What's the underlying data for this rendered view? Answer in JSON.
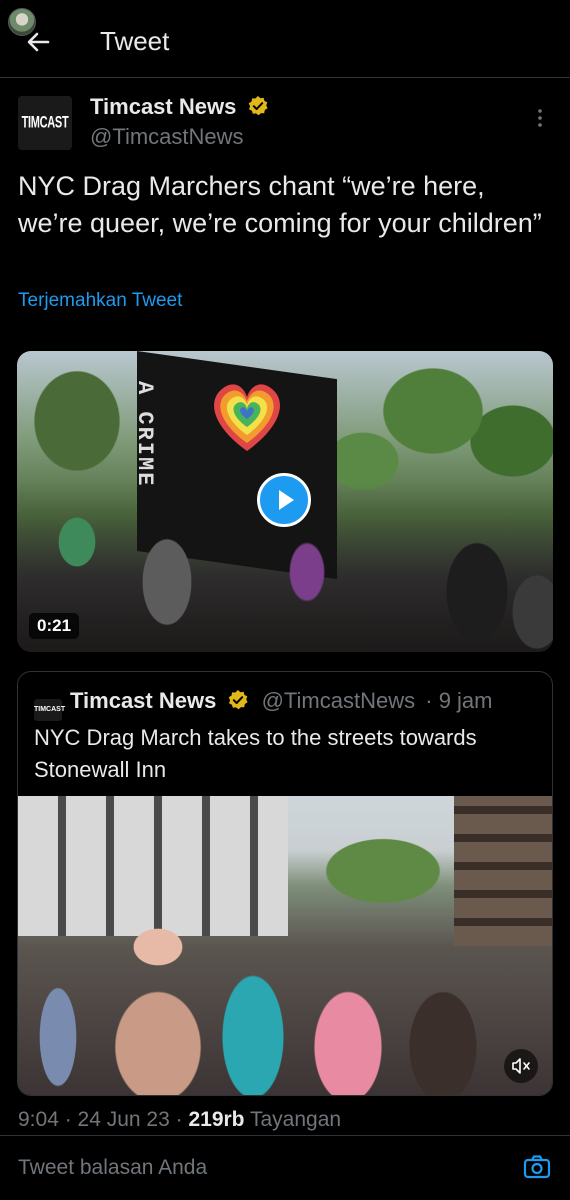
{
  "header": {
    "title": "Tweet"
  },
  "tweet": {
    "author": {
      "name": "Timcast News",
      "handle": "@TimcastNews",
      "logo_text": "TIMCAST"
    },
    "text": "NYC Drag Marchers chant “we’re here, we’re queer, we’re coming for your children”",
    "translate_label": "Terjemahkan Tweet",
    "video": {
      "duration": "0:21",
      "flag_text": "A CRIME"
    },
    "meta": {
      "time": "9:04",
      "date": "24 Jun 23",
      "views_count": "219rb",
      "views_label": "Tayangan"
    }
  },
  "quoted": {
    "logo_text": "TIMCAST",
    "name": "Timcast News",
    "handle": "@TimcastNews",
    "time_ago": "· 9 jam",
    "text": "NYC Drag March takes to the streets towards Stonewall Inn"
  },
  "reply": {
    "placeholder": "Tweet balasan Anda"
  },
  "colors": {
    "background": "#000000",
    "text": "#e7e9ea",
    "muted": "#71767b",
    "accent": "#1d9bf0",
    "verified": "#e2b719",
    "border": "#2f3336"
  },
  "icons": {
    "back": "arrow-left-icon",
    "verified": "verified-badge-icon",
    "more": "more-vertical-icon",
    "play": "play-icon",
    "mute": "muted-speaker-icon",
    "camera": "camera-icon"
  }
}
